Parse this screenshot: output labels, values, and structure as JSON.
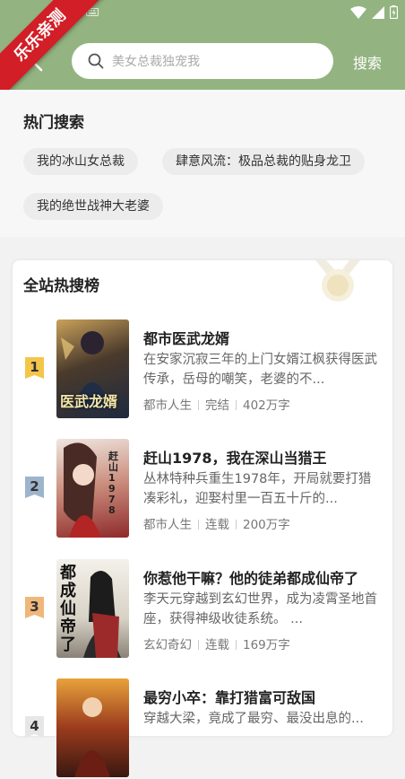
{
  "status_bar": {
    "icons": [
      "keyboard-icon",
      "wifi-icon",
      "signal-icon",
      "battery-icon"
    ]
  },
  "ribbon": {
    "text": "乐乐亲测"
  },
  "header": {
    "search_placeholder": "美女总裁独宠我",
    "search_button": "搜索"
  },
  "hot_search": {
    "title": "热门搜索",
    "tags": [
      "我的冰山女总裁",
      "肆意风流：极品总裁的贴身龙卫",
      "我的绝世战神大老婆"
    ]
  },
  "ranking": {
    "title": "全站热搜榜",
    "books": [
      {
        "rank": "1",
        "cover_text": "医武龙婿",
        "title": "都市医武龙婿",
        "desc": "在安家沉寂三年的上门女婿江枫获得医武传承，岳母的嘲笑，老婆的不...",
        "category": "都市人生",
        "status": "完结",
        "words": "402万字"
      },
      {
        "rank": "2",
        "cover_text": "赶山1978",
        "title": "赶山1978，我在深山当猎王",
        "desc": "丛林特种兵重生1978年，开局就要打猎凑彩礼，迎娶村里一百五十斤的...",
        "category": "都市人生",
        "status": "连载",
        "words": "200万字"
      },
      {
        "rank": "3",
        "cover_text": "都成仙帝了",
        "title": "你惹他干嘛？他的徒弟都成仙帝了",
        "desc": "李天元穿越到玄幻世界，成为凌霄圣地首座，获得神级收徒系统。 ...",
        "category": "玄幻奇幻",
        "status": "连载",
        "words": "169万字"
      },
      {
        "rank": "4",
        "cover_text": "",
        "title": "最穷小卒：靠打猎富可敌国",
        "desc": "穿越大梁，竟成了最穷、最没出息的...",
        "category": "",
        "status": "",
        "words": ""
      }
    ]
  },
  "colors": {
    "header_green": "#93b481",
    "ribbon_red": "#d21e26",
    "rank1": "#f3c64a",
    "rank2": "#9db4cc",
    "rank3": "#f0b67a"
  }
}
